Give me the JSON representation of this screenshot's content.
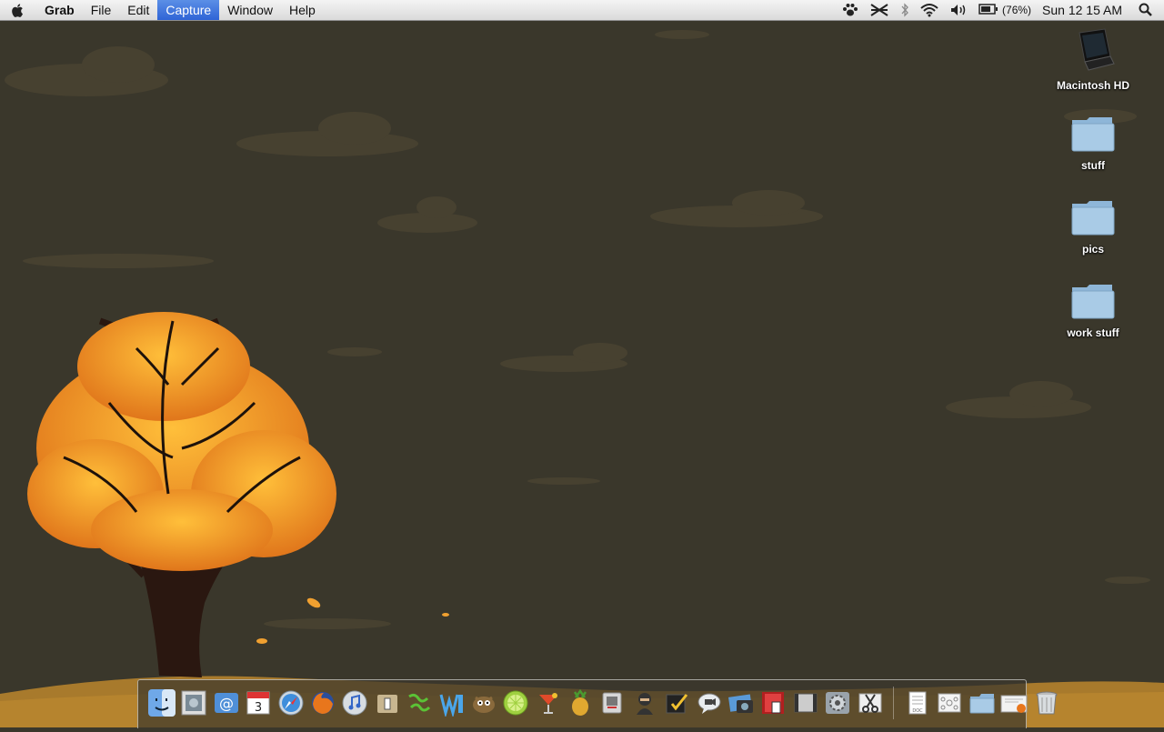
{
  "menubar": {
    "app_name": "Grab",
    "menus": [
      "File",
      "Edit",
      "Capture",
      "Window",
      "Help"
    ],
    "active_menu": "Capture",
    "status": {
      "icons": [
        "paw-icon",
        "network-off-icon",
        "bluetooth-icon",
        "wifi-icon",
        "volume-icon",
        "battery-icon",
        "spotlight-search-icon"
      ],
      "battery_percent": "(76%)",
      "clock": "Sun 12 15 AM"
    }
  },
  "desktop": {
    "icons": [
      {
        "label": "Macintosh HD",
        "type": "drive"
      },
      {
        "label": "stuff",
        "type": "folder"
      },
      {
        "label": "pics",
        "type": "folder"
      },
      {
        "label": "work stuff",
        "type": "folder"
      }
    ]
  },
  "dock": {
    "apps": [
      "finder-icon",
      "preview-icon",
      "mail-icon",
      "ical-icon",
      "safari-icon",
      "firefox-icon",
      "itunes-icon",
      "app-icon",
      "dreamweaver-icon",
      "word-icon",
      "gimp-icon",
      "lime-icon",
      "cocktail-icon",
      "pineapple-icon",
      "grab-app-icon",
      "ninja-icon",
      "textedit-icon",
      "ichat-icon",
      "iphoto-icon",
      "photobooth-icon",
      "imovie-icon",
      "system-preferences-icon",
      "grab-scissors-icon"
    ],
    "stacks": [
      "documents-stack-icon",
      "network-stack-icon",
      "folder-stack-icon",
      "downloads-stack-icon",
      "trash-icon"
    ],
    "ical_date": "3"
  },
  "colors": {
    "menu_highlight": "#2f64d6",
    "wallpaper": "#3a372b",
    "leaves": "#f19a22"
  }
}
